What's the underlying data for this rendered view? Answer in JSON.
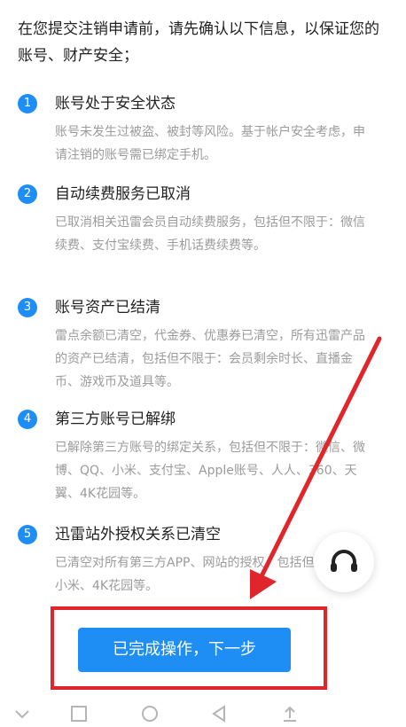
{
  "intro": "在您提交注销申请前，请先确认以下信息，以保证您的账号、财产安全；",
  "items": [
    {
      "num": "1",
      "title": "账号处于安全状态",
      "desc": "账号未发生过被盗、被封等风险。基于帐户安全考虑，申请注销的账号需已绑定手机。"
    },
    {
      "num": "2",
      "title": "自动续费服务已取消",
      "desc": "已取消相关迅雷会员自动续费服务，包括但不限于：微信续费、支付宝续费、手机话费续费等。"
    },
    {
      "num": "3",
      "title": "账号资产已结清",
      "desc": "雷点余额已清空，代金券、优惠券已清空，所有迅雷产品的资产已结清，包括但不限于：会员剩余时长、直播金币、游戏币及道具等。"
    },
    {
      "num": "4",
      "title": "第三方账号已解绑",
      "desc": "已解除第三方账号的绑定关系，包括但不限于：微信、微博、QQ、小米、支付宝、Apple账号、人人、360、天翼、4K花园等。"
    },
    {
      "num": "5",
      "title": "迅雷站外授权关系已清空",
      "desc": "已清空对所有第三方APP、网站的授权，包括但不限于：小米、4K花园等。"
    }
  ],
  "button": {
    "label": "已完成操作，下一步"
  },
  "icons": {
    "support": "headset-icon"
  },
  "colors": {
    "accent": "#1e8ef5",
    "annotation": "#e0262b"
  }
}
